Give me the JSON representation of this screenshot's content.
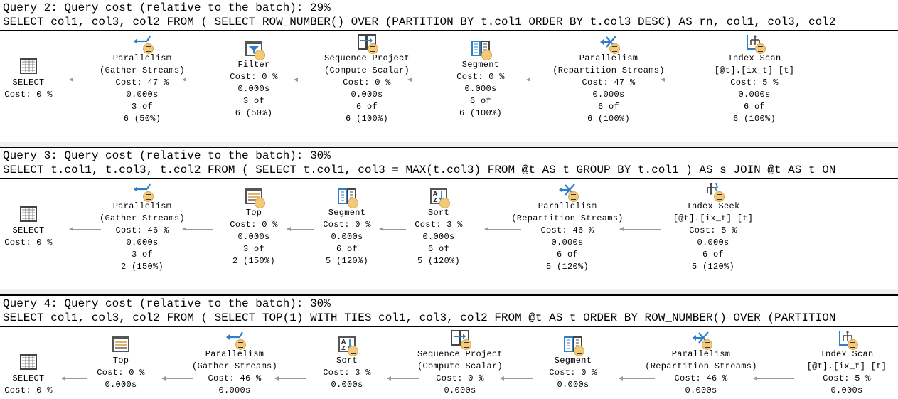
{
  "queries": [
    {
      "title": "Query 2: Query cost (relative to the batch): 29%",
      "sql": "SELECT col1, col3, col2 FROM ( SELECT ROW_NUMBER() OVER (PARTITION BY t.col1 ORDER BY t.col3 DESC) AS rn, col1, col3, col2",
      "nodes": [
        {
          "icon": "select-icon",
          "lines": [
            "SELECT",
            "Cost: 0 %"
          ]
        },
        {
          "icon": "parallelism-gather-icon",
          "lines": [
            "Parallelism",
            "(Gather Streams)",
            "Cost: 47 %",
            "0.000s",
            "3 of",
            "6 (50%)"
          ]
        },
        {
          "icon": "filter-icon",
          "lines": [
            "Filter",
            "Cost: 0 %",
            "0.000s",
            "3 of",
            "6 (50%)"
          ]
        },
        {
          "icon": "sequence-project-icon",
          "lines": [
            "Sequence Project",
            "(Compute Scalar)",
            "Cost: 0 %",
            "0.000s",
            "6 of",
            "6 (100%)"
          ]
        },
        {
          "icon": "segment-icon",
          "lines": [
            "Segment",
            "Cost: 0 %",
            "0.000s",
            "6 of",
            "6 (100%)"
          ]
        },
        {
          "icon": "parallelism-repartition-icon",
          "lines": [
            "Parallelism",
            "(Repartition Streams)",
            "Cost: 47 %",
            "0.000s",
            "6 of",
            "6 (100%)"
          ]
        },
        {
          "icon": "index-scan-icon",
          "lines": [
            "Index Scan",
            "[@t].[ix_t] [t]",
            "Cost: 5 %",
            "0.000s",
            "6 of",
            "6 (100%)"
          ]
        }
      ]
    },
    {
      "title": "Query 3: Query cost (relative to the batch): 30%",
      "sql": "SELECT t.col1, t.col3, t.col2 FROM ( SELECT t.col1, col3 = MAX(t.col3) FROM @t AS t GROUP BY t.col1 ) AS s JOIN @t AS t ON",
      "nodes": [
        {
          "icon": "select-icon",
          "lines": [
            "SELECT",
            "Cost: 0 %"
          ]
        },
        {
          "icon": "parallelism-gather-icon",
          "lines": [
            "Parallelism",
            "(Gather Streams)",
            "Cost: 46 %",
            "0.000s",
            "3 of",
            "2 (150%)"
          ]
        },
        {
          "icon": "top-icon",
          "lines": [
            "Top",
            "Cost: 0 %",
            "0.000s",
            "3 of",
            "2 (150%)"
          ]
        },
        {
          "icon": "segment-icon",
          "lines": [
            "Segment",
            "Cost: 0 %",
            "0.000s",
            "6 of",
            "5 (120%)"
          ]
        },
        {
          "icon": "sort-icon",
          "lines": [
            "Sort",
            "Cost: 3 %",
            "0.000s",
            "6 of",
            "5 (120%)"
          ]
        },
        {
          "icon": "parallelism-repartition-icon",
          "lines": [
            "Parallelism",
            "(Repartition Streams)",
            "Cost: 46 %",
            "0.000s",
            "6 of",
            "5 (120%)"
          ]
        },
        {
          "icon": "index-seek-icon",
          "lines": [
            "Index Seek",
            "[@t].[ix_t] [t]",
            "Cost: 5 %",
            "0.000s",
            "6 of",
            "5 (120%)"
          ]
        }
      ]
    },
    {
      "title": "Query 4: Query cost (relative to the batch): 30%",
      "sql": "SELECT col1, col3, col2 FROM ( SELECT TOP(1) WITH TIES col1, col3, col2 FROM @t AS t ORDER BY ROW_NUMBER() OVER (PARTITION",
      "nodes": [
        {
          "icon": "select-icon",
          "lines": [
            "SELECT",
            "Cost: 0 %"
          ]
        },
        {
          "icon": "top-icon",
          "lines": [
            "Top",
            "Cost: 0 %",
            "0.000s"
          ]
        },
        {
          "icon": "parallelism-gather-icon",
          "lines": [
            "Parallelism",
            "(Gather Streams)",
            "Cost: 46 %",
            "0.000s"
          ]
        },
        {
          "icon": "sort-icon",
          "lines": [
            "Sort",
            "Cost: 3 %",
            "0.000s"
          ]
        },
        {
          "icon": "sequence-project-icon",
          "lines": [
            "Sequence Project",
            "(Compute Scalar)",
            "Cost: 0 %",
            "0.000s"
          ]
        },
        {
          "icon": "segment-icon",
          "lines": [
            "Segment",
            "Cost: 0 %",
            "0.000s"
          ]
        },
        {
          "icon": "parallelism-repartition-icon",
          "lines": [
            "Parallelism",
            "(Repartition Streams)",
            "Cost: 46 %",
            "0.000s"
          ]
        },
        {
          "icon": "index-scan-icon",
          "lines": [
            "Index Scan",
            "[@t].[ix_t] [t]",
            "Cost: 5 %",
            "0.000s"
          ]
        }
      ]
    }
  ]
}
